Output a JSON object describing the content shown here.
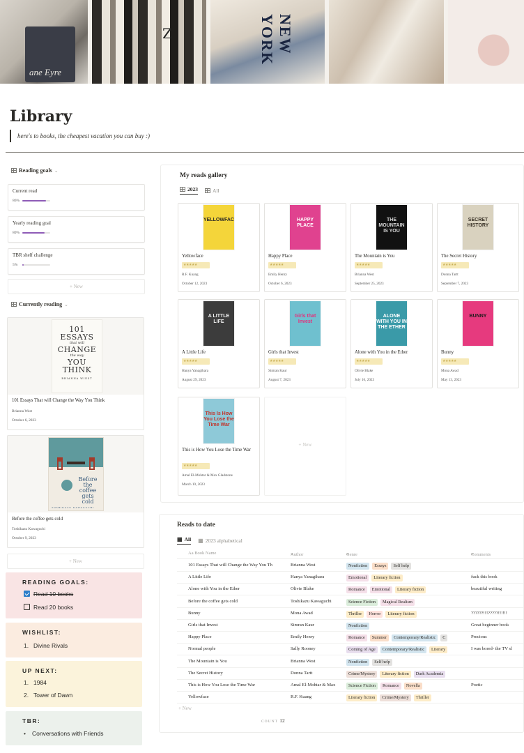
{
  "page": {
    "title": "Library",
    "quote": "here's to books, the cheapest vacation you can buy :)",
    "banner_book_text": "ane Eyre",
    "banner_spine_letter": "Z",
    "banner_shirt_text": "NEW YORK"
  },
  "reading_goals": {
    "heading": "Reading goals",
    "items": [
      {
        "name": "Current read",
        "percent": "86%",
        "fill": 0.86
      },
      {
        "name": "Yearly reading goal",
        "percent": "80%",
        "fill": 0.8
      },
      {
        "name": "TBR shelf challenge",
        "percent": "5%",
        "fill": 0.05
      }
    ],
    "new_label": "+ New"
  },
  "currently_reading": {
    "heading": "Currently reading",
    "items": [
      {
        "title": "101 Essays That will Change the Way You Think",
        "author": "Brianna West",
        "date": "October 6, 2023",
        "cover": {
          "l1": "101",
          "l2": "ESSAYS",
          "s1": "that will",
          "l3": "CHANGE",
          "s2": "the way",
          "l4": "YOU",
          "l5": "THINK",
          "au": "BRIANNA WIEST"
        }
      },
      {
        "title": "Before the coffee gets cold",
        "author": "Toshikazu Kawaguchi",
        "date": "October 9, 2023",
        "cover": {
          "t": "Before the coffee gets cold",
          "au": "TOSHIKAZU KAWAGUCHI"
        }
      }
    ],
    "new_label": "+ New"
  },
  "blocks": {
    "reading_goals": {
      "heading": "READING GOALS:",
      "items": [
        {
          "label": "Read 10 books",
          "checked": true
        },
        {
          "label": "Read 20 books",
          "checked": false
        }
      ]
    },
    "wishlist": {
      "heading": "WISHLIST:",
      "items": [
        "Divine Rivals"
      ]
    },
    "up_next": {
      "heading": "UP NEXT:",
      "items": [
        "1984",
        "Tower of Dawn"
      ]
    },
    "tbr": {
      "heading": "TBR:",
      "items": [
        "Conversations with Friends"
      ]
    }
  },
  "gallery": {
    "title": "My reads gallery",
    "tabs": [
      "2023",
      "All"
    ],
    "rating": "★★★★★",
    "cards": [
      {
        "title": "Yellowface",
        "author": "R.F. Kuang",
        "date": "October 12, 2023",
        "cover_text": "YELLOWFACE",
        "cover_bg": "#f4d53a",
        "cover_fg": "#2b2a27"
      },
      {
        "title": "Happy Place",
        "author": "Emily Henry",
        "date": "October 6, 2023",
        "cover_text": "HAPPY PLACE",
        "cover_bg": "#e0428f",
        "cover_fg": "#ffffff"
      },
      {
        "title": "The Mountain is You",
        "author": "Brianna West",
        "date": "September 25, 2023",
        "cover_text": "THE MOUNTAIN IS YOU",
        "cover_bg": "#111111",
        "cover_fg": "#d8d8d8"
      },
      {
        "title": "The Secret History",
        "author": "Donna Tartt",
        "date": "September 7, 2023",
        "cover_text": "SECRET HISTORY",
        "cover_bg": "#d9d2bf",
        "cover_fg": "#3a3328"
      },
      {
        "title": "A Little Life",
        "author": "Hanya Yanagihara",
        "date": "August 29, 2023",
        "cover_text": "A LITTLE LIFE",
        "cover_bg": "#3c3c3c",
        "cover_fg": "#f0f0f0"
      },
      {
        "title": "Girls that Invest",
        "author": "Simran Kaur",
        "date": "August 7, 2023",
        "cover_text": "Girls that Invest",
        "cover_bg": "#6fc0cf",
        "cover_fg": "#e2327d"
      },
      {
        "title": "Alone with You in the Ether",
        "author": "Olivie Blake",
        "date": "July 16, 2023",
        "cover_text": "ALONE WITH YOU IN THE ETHER",
        "cover_bg": "#3a9aa8",
        "cover_fg": "#ffffff"
      },
      {
        "title": "Bunny",
        "author": "Mona Awad",
        "date": "May 13, 2023",
        "cover_text": "BUNNY",
        "cover_bg": "#e63a7e",
        "cover_fg": "#1a1a1a"
      },
      {
        "title": "This is How You Lose the Time War",
        "author": "Amal El-Mohtar & Max Gladstone",
        "date": "March 10, 2023",
        "cover_text": "This Is How You Lose the Time War",
        "cover_bg": "#8ec9d8",
        "cover_fg": "#c2332a"
      }
    ],
    "new_label": "+ New"
  },
  "reads_table": {
    "title": "Reads to date",
    "tabs": [
      "All",
      "2023 alphabetical"
    ],
    "headers": [
      "Aa Book Name",
      "Author",
      "Genre",
      "Comments"
    ],
    "rows": [
      {
        "book": "101 Essays That will Change the Way You Th",
        "author": "Brianna West",
        "genres": [
          [
            "Nonfiction",
            "blue"
          ],
          [
            "Essays",
            "orange"
          ],
          [
            "Self help",
            "gray"
          ]
        ],
        "comment": ""
      },
      {
        "book": "A Little Life",
        "author": "Hanya Yanagihara",
        "genres": [
          [
            "Emotional",
            "pink"
          ],
          [
            "Literary fiction",
            "yellow"
          ]
        ],
        "comment": "fuck this book"
      },
      {
        "book": "Alone with You in the Ether",
        "author": "Olivie Blake",
        "genres": [
          [
            "Romance",
            "pink"
          ],
          [
            "Emotional",
            "pink"
          ],
          [
            "Literary fiction",
            "yellow"
          ]
        ],
        "comment": "beautiful writing"
      },
      {
        "book": "Before the coffee gets cold",
        "author": "Toshikazu Kawaguchi",
        "genres": [
          [
            "Science Fiction",
            "green"
          ],
          [
            "Magical Realism",
            "pink"
          ]
        ],
        "comment": ""
      },
      {
        "book": "Bunny",
        "author": "Mona Awad",
        "genres": [
          [
            "Thriller",
            "yellow"
          ],
          [
            "Horror",
            "red"
          ],
          [
            "Literary fiction",
            "yellow"
          ]
        ],
        "comment": "??????!!!?????!!!!!!"
      },
      {
        "book": "Girls that Invest",
        "author": "Simran Kaur",
        "genres": [
          [
            "Nonfiction",
            "blue"
          ]
        ],
        "comment": "Great beginner book"
      },
      {
        "book": "Happy Place",
        "author": "Emily Henry",
        "genres": [
          [
            "Romance",
            "pink"
          ],
          [
            "Summer",
            "orange"
          ],
          [
            "Contemporary/Realistic",
            "blue"
          ],
          [
            "C",
            "gray"
          ]
        ],
        "comment": "Precious"
      },
      {
        "book": "Normal people",
        "author": "Sally Rooney",
        "genres": [
          [
            "Coming of Age",
            "purple"
          ],
          [
            "Contemporary/Realistic",
            "blue"
          ],
          [
            "Literary",
            "yellow"
          ]
        ],
        "comment": "I was bored- the TV sl"
      },
      {
        "book": "The Mountain is You",
        "author": "Brianna West",
        "genres": [
          [
            "Nonfiction",
            "blue"
          ],
          [
            "Self help",
            "gray"
          ]
        ],
        "comment": ""
      },
      {
        "book": "The Secret History",
        "author": "Donna Tartt",
        "genres": [
          [
            "Crime/Mystery",
            "brown"
          ],
          [
            "Literary fiction",
            "yellow"
          ],
          [
            "Dark Academia",
            "purple"
          ]
        ],
        "comment": ""
      },
      {
        "book": "This is How You Lose the Time War",
        "author": "Amal El-Mohtar & Max",
        "genres": [
          [
            "Science Fiction",
            "green"
          ],
          [
            "Romance",
            "pink"
          ],
          [
            "Novella",
            "orange"
          ]
        ],
        "comment": "Poetic"
      },
      {
        "book": "Yellowface",
        "author": "R.F. Kuang",
        "genres": [
          [
            "Literary fiction",
            "yellow"
          ],
          [
            "Crime/Mystery",
            "brown"
          ],
          [
            "Thriller",
            "yellow"
          ]
        ],
        "comment": ""
      }
    ],
    "new_label": "+ New",
    "count_label": "COUNT",
    "count_value": "12"
  },
  "colors": {
    "goal_fill": "#8e5bb7",
    "block_pink": "#f9e4e4",
    "block_orange": "#fbece0",
    "block_yellow": "#fbf3db",
    "block_green": "#ecf1ec"
  }
}
